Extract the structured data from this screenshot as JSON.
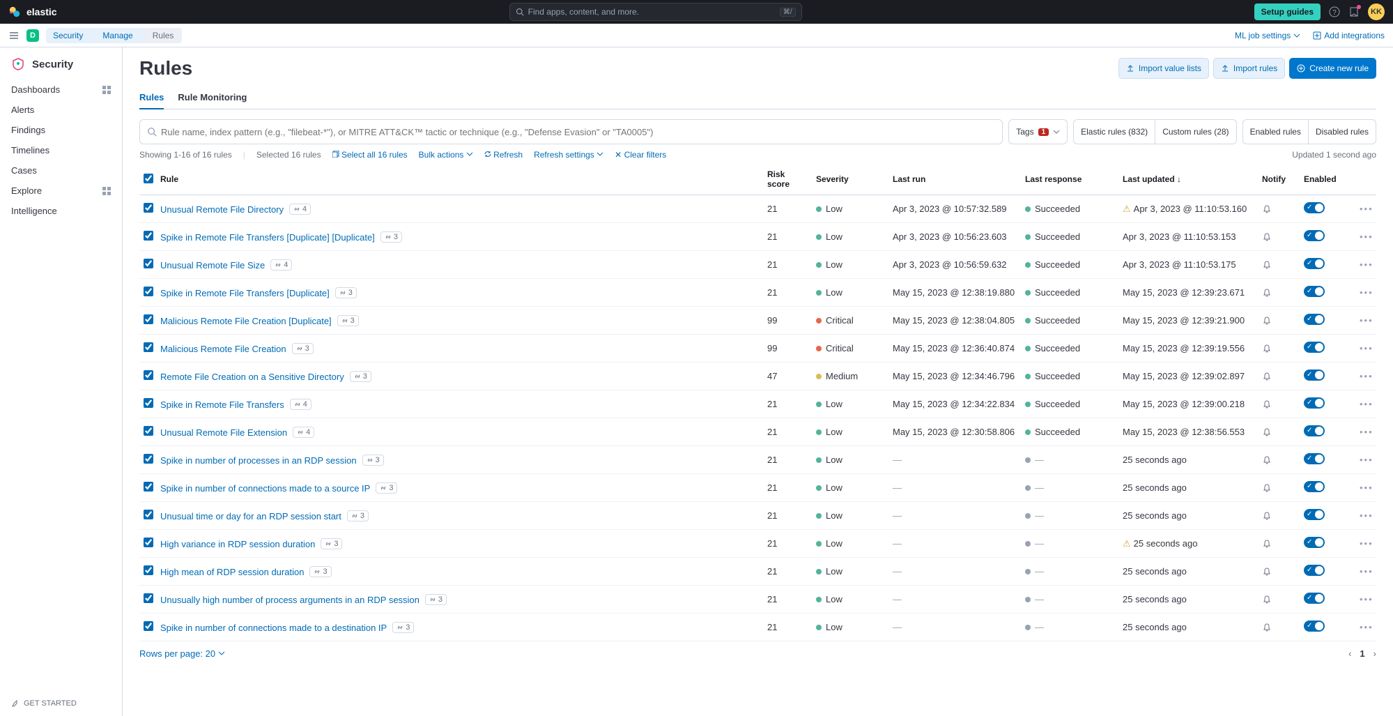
{
  "brand": "elastic",
  "search_placeholder": "Find apps, content, and more.",
  "search_kbd": "⌘/",
  "setup_guides": "Setup guides",
  "avatar": "KK",
  "space_letter": "D",
  "breadcrumbs": [
    "Security",
    "Manage",
    "Rules"
  ],
  "ml_job_settings": "ML job settings",
  "add_integrations": "Add integrations",
  "sidebar": {
    "title": "Security",
    "items": [
      "Dashboards",
      "Alerts",
      "Findings",
      "Timelines",
      "Cases",
      "Explore",
      "Intelligence"
    ],
    "get_started": "GET STARTED"
  },
  "page": {
    "title": "Rules",
    "actions": {
      "import_value_lists": "Import value lists",
      "import_rules": "Import rules",
      "create": "Create new rule"
    },
    "tabs": [
      "Rules",
      "Rule Monitoring"
    ],
    "active_tab": 0
  },
  "filters": {
    "search_placeholder": "Rule name, index pattern (e.g., \"filebeat-*\"), or MITRE ATT&CK™ tactic or technique (e.g., \"Defense Evasion\" or \"TA0005\")",
    "tags_label": "Tags",
    "tags_count": "1",
    "elastic_rules": "Elastic rules (832)",
    "custom_rules": "Custom rules (28)",
    "enabled": "Enabled rules",
    "disabled": "Disabled rules"
  },
  "toolbar": {
    "showing": "Showing 1-16 of 16 rules",
    "selected": "Selected 16 rules",
    "select_all": "Select all 16 rules",
    "bulk": "Bulk actions",
    "refresh": "Refresh",
    "refresh_settings": "Refresh settings",
    "clear": "Clear filters",
    "updated": "Updated 1 second ago"
  },
  "cols": {
    "rule": "Rule",
    "risk": "Risk score",
    "sev": "Severity",
    "lastrun": "Last run",
    "resp": "Last response",
    "updated": "Last updated",
    "notify": "Notify",
    "enabled": "Enabled"
  },
  "rows": [
    {
      "name": "Unusual Remote File Directory",
      "link": 4,
      "risk": 21,
      "sev": "Low",
      "run": "Apr 3, 2023 @ 10:57:32.589",
      "resp": "Succeeded",
      "warn": true,
      "upd": "Apr 3, 2023 @ 11:10:53.160"
    },
    {
      "name": "Spike in Remote File Transfers [Duplicate] [Duplicate]",
      "link": 3,
      "risk": 21,
      "sev": "Low",
      "run": "Apr 3, 2023 @ 10:56:23.603",
      "resp": "Succeeded",
      "upd": "Apr 3, 2023 @ 11:10:53.153"
    },
    {
      "name": "Unusual Remote File Size",
      "link": 4,
      "risk": 21,
      "sev": "Low",
      "run": "Apr 3, 2023 @ 10:56:59.632",
      "resp": "Succeeded",
      "upd": "Apr 3, 2023 @ 11:10:53.175"
    },
    {
      "name": "Spike in Remote File Transfers [Duplicate]",
      "link": 3,
      "risk": 21,
      "sev": "Low",
      "run": "May 15, 2023 @ 12:38:19.880",
      "resp": "Succeeded",
      "upd": "May 15, 2023 @ 12:39:23.671"
    },
    {
      "name": "Malicious Remote File Creation [Duplicate]",
      "link": 3,
      "risk": 99,
      "sev": "Critical",
      "run": "May 15, 2023 @ 12:38:04.805",
      "resp": "Succeeded",
      "upd": "May 15, 2023 @ 12:39:21.900"
    },
    {
      "name": "Malicious Remote File Creation",
      "link": 3,
      "risk": 99,
      "sev": "Critical",
      "run": "May 15, 2023 @ 12:36:40.874",
      "resp": "Succeeded",
      "upd": "May 15, 2023 @ 12:39:19.556"
    },
    {
      "name": "Remote File Creation on a Sensitive Directory",
      "link": 3,
      "risk": 47,
      "sev": "Medium",
      "run": "May 15, 2023 @ 12:34:46.796",
      "resp": "Succeeded",
      "upd": "May 15, 2023 @ 12:39:02.897"
    },
    {
      "name": "Spike in Remote File Transfers",
      "link": 4,
      "risk": 21,
      "sev": "Low",
      "run": "May 15, 2023 @ 12:34:22.834",
      "resp": "Succeeded",
      "upd": "May 15, 2023 @ 12:39:00.218"
    },
    {
      "name": "Unusual Remote File Extension",
      "link": 4,
      "risk": 21,
      "sev": "Low",
      "run": "May 15, 2023 @ 12:30:58.806",
      "resp": "Succeeded",
      "upd": "May 15, 2023 @ 12:38:56.553"
    },
    {
      "name": "Spike in number of processes in an RDP session",
      "link": 3,
      "risk": 21,
      "sev": "Low",
      "run": "—",
      "resp": "—",
      "upd": "25 seconds ago"
    },
    {
      "name": "Spike in number of connections made to a source IP",
      "link": 3,
      "risk": 21,
      "sev": "Low",
      "run": "—",
      "resp": "—",
      "upd": "25 seconds ago"
    },
    {
      "name": "Unusual time or day for an RDP session start",
      "link": 3,
      "risk": 21,
      "sev": "Low",
      "run": "—",
      "resp": "—",
      "upd": "25 seconds ago"
    },
    {
      "name": "High variance in RDP session duration",
      "link": 3,
      "risk": 21,
      "sev": "Low",
      "run": "—",
      "resp": "—",
      "warn": true,
      "upd": "25 seconds ago"
    },
    {
      "name": "High mean of RDP session duration",
      "link": 3,
      "risk": 21,
      "sev": "Low",
      "run": "—",
      "resp": "—",
      "upd": "25 seconds ago"
    },
    {
      "name": "Unusually high number of process arguments in an RDP session",
      "link": 3,
      "risk": 21,
      "sev": "Low",
      "run": "—",
      "resp": "—",
      "upd": "25 seconds ago"
    },
    {
      "name": "Spike in number of connections made to a destination IP",
      "link": 3,
      "risk": 21,
      "sev": "Low",
      "run": "—",
      "resp": "—",
      "upd": "25 seconds ago"
    }
  ],
  "footer": {
    "rows_per_page": "Rows per page: 20",
    "page": "1"
  }
}
